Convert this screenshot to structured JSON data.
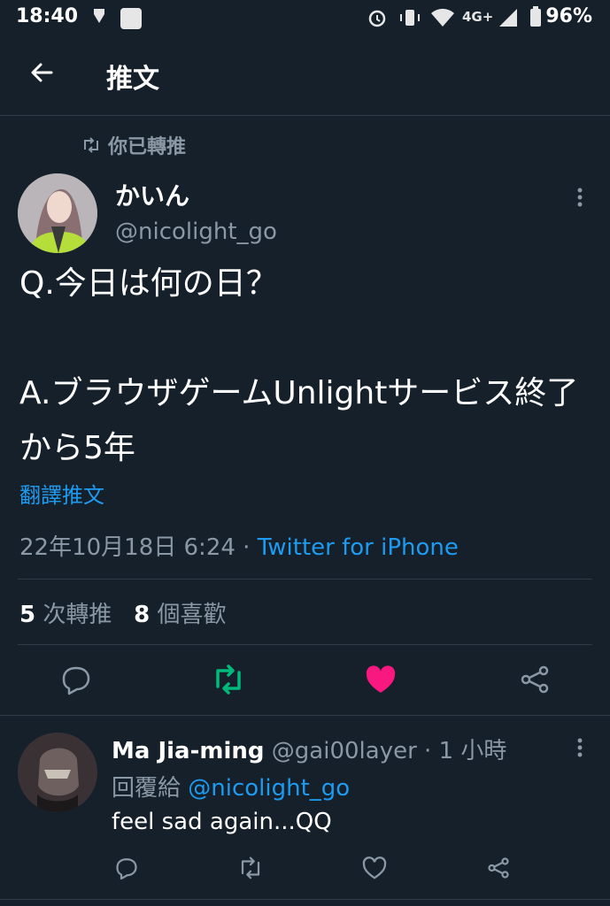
{
  "status_bar": {
    "time": "18:40",
    "battery": "96%",
    "network": "4G+",
    "icons": [
      "notification-icon",
      "app-icon",
      "alarm-icon",
      "vibrate-icon",
      "wifi-icon",
      "signal-icon",
      "battery-icon"
    ]
  },
  "header": {
    "title": "推文",
    "back_icon": "arrow-left-icon"
  },
  "tweet": {
    "retweet_label": "你已轉推",
    "author_name": "かいん",
    "author_handle": "@nicolight_go",
    "text": "Q.今日は何の日？\n\nA.ブラウザゲームUnlightサービス終了から5年",
    "translate_label": "翻譯推文",
    "date": "22年10月18日 6:24 · ",
    "source": "Twitter for iPhone",
    "retweet_count": "5",
    "retweet_count_label": " 次轉推",
    "like_count": "8",
    "like_count_label": " 個喜歡",
    "colors": {
      "retweeted": "#00ba7c",
      "liked": "#f91880",
      "link": "#1d9bf0"
    }
  },
  "reply": {
    "author_name": "Ma Jia-ming",
    "author_handle": " @gai00layer · 1 小時",
    "reply_to_prefix": "回覆給 ",
    "reply_to_mention": "@nicolight_go",
    "text": "feel sad again...QQ"
  }
}
